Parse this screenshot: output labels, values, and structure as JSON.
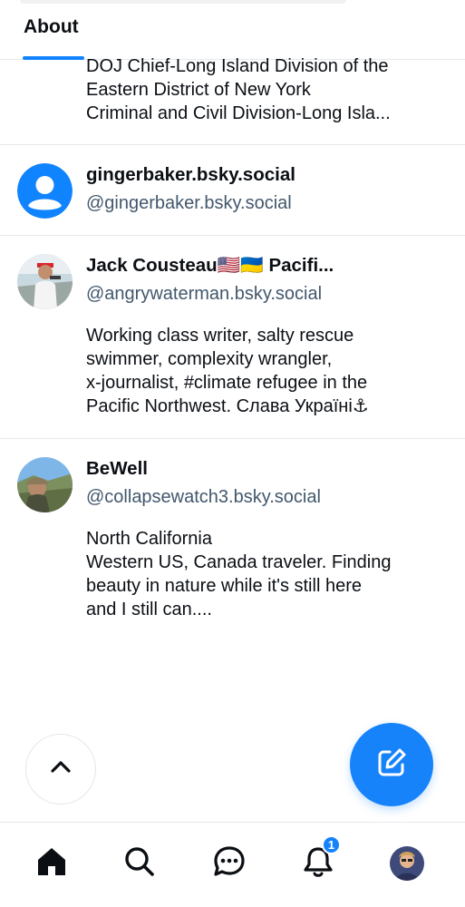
{
  "header": {
    "tab_label": "About"
  },
  "accent_color": "#1083fe",
  "feed": {
    "partial_entry": {
      "lines": [
        "DOJ Chief-Long Island Division of the",
        "Eastern District of New York",
        "Criminal and Civil Division-Long Isla..."
      ]
    },
    "users": [
      {
        "name": "gingerbaker.bsky.social",
        "handle": "@gingerbaker.bsky.social",
        "avatar": "default-avatar-icon",
        "description": []
      },
      {
        "name": "Jack Cousteau🇺🇸🇺🇦 Pacifi...",
        "handle": "@angrywaterman.bsky.social",
        "avatar": "photo-avatar",
        "description": [
          "Working class writer, salty rescue",
          "swimmer, complexity wrangler,",
          "x-journalist, #climate refugee in the",
          "Pacific Northwest. Слава Україні⚓"
        ]
      },
      {
        "name": "BeWell",
        "handle": "@collapsewatch3.bsky.social",
        "avatar": "photo-avatar",
        "description": [
          "North California",
          "Western US, Canada traveler. Finding",
          "beauty in nature while it's still here",
          "and I still can...."
        ]
      }
    ]
  },
  "fab": {
    "scroll_top_icon": "chevron-up-icon",
    "compose_icon": "compose-icon"
  },
  "bottom_nav": {
    "items": [
      "home-icon",
      "search-icon",
      "chat-icon",
      "bell-icon",
      "profile-avatar"
    ],
    "notification_count": "1"
  }
}
